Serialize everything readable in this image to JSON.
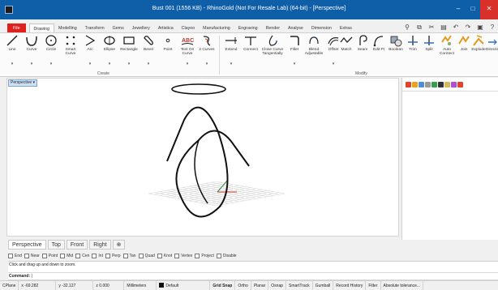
{
  "window": {
    "title": "Bust 001 (1556 KB) - RhinoGold (Not For Resale Lab) (64-bit) - [Perspective]",
    "controls": [
      "–",
      "□",
      "✕"
    ]
  },
  "menu_tabs": [
    "File",
    "Drawing",
    "Modelling",
    "Transform",
    "Gems",
    "Jewellery",
    "Artistica",
    "Clayoo",
    "Manufacturing",
    "Engraving",
    "Render",
    "Analyse",
    "Dimension",
    "Extras"
  ],
  "active_tab": "Drawing",
  "ribbon": {
    "create_tools": [
      {
        "label": "Line"
      },
      {
        "label": "Curve"
      },
      {
        "label": "Circle"
      },
      {
        "label": "Smart Curve"
      },
      {
        "label": "Arc"
      },
      {
        "label": "Ellipse"
      },
      {
        "label": "Rectangle"
      },
      {
        "label": "Bevel"
      },
      {
        "label": "Point"
      },
      {
        "label": "Text On Curve"
      },
      {
        "label": "2 Curves"
      }
    ],
    "modify_tools": [
      {
        "label": "Extend"
      },
      {
        "label": "Connect"
      },
      {
        "label": "Close Curve Tangentially"
      },
      {
        "label": "Fillet"
      },
      {
        "label": "Blend Adjustable"
      },
      {
        "label": "Offset"
      },
      {
        "label": "Match"
      },
      {
        "label": "Seam"
      },
      {
        "label": "Edit Pt"
      },
      {
        "label": "Boolean"
      },
      {
        "label": "Trim"
      },
      {
        "label": "Split"
      },
      {
        "label": "Auto Connect"
      },
      {
        "label": "Join"
      },
      {
        "label": "Explode"
      },
      {
        "label": "Direction"
      }
    ],
    "group_labels": {
      "create": "Create",
      "modify": "Modify"
    },
    "dropdown_glyph": "▾"
  },
  "viewport": {
    "label": "Perspective ▾"
  },
  "viewport_tabs": [
    "Perspective",
    "Top",
    "Front",
    "Right",
    "⊕"
  ],
  "active_viewport_tab": "Perspective",
  "osnaps": [
    "End",
    "Near",
    "Point",
    "Mid",
    "Cen",
    "Int",
    "Perp",
    "Tan",
    "Quad",
    "Knot",
    "Vertex",
    "Project",
    "Disable"
  ],
  "command_history": "Click and drag up and down to zoom.",
  "command_prompt": "Command:",
  "status": {
    "cplane": "CPlane",
    "x": "x -69.282",
    "y": "y -32.127",
    "z": "z 0.000",
    "units": "Millimeters",
    "layer": "Default",
    "toggles": [
      "Grid Snap",
      "Ortho",
      "Planar",
      "Osnap",
      "SmartTrack",
      "Gumball",
      "Record History",
      "Filter",
      "Absolute tolerance..."
    ]
  },
  "colors": {
    "titlebar": "#0f5ea8",
    "file_tab": "#e0201c",
    "close_button": "#d9312a",
    "viewport_bg": "#ffffff",
    "grid": "#d7d7d7",
    "axis_x": "#c0392b",
    "axis_y": "#2e8b3c"
  }
}
